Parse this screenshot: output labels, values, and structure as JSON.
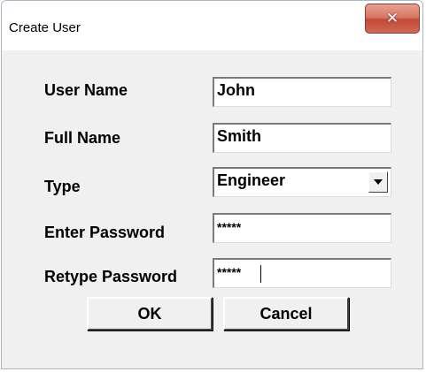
{
  "window": {
    "title": "Create User",
    "close_glyph": "✕",
    "close_icon": "close-icon"
  },
  "form": {
    "user_name": {
      "label": "User Name",
      "value": "John"
    },
    "full_name": {
      "label": "Full Name",
      "value": "Smith"
    },
    "type": {
      "label": "Type",
      "value": "Engineer",
      "arrow_icon": "dropdown-arrow-icon"
    },
    "enter_password": {
      "label": "Enter Password",
      "value": "*****"
    },
    "retype_password": {
      "label": "Retype Password",
      "value": "*****"
    }
  },
  "buttons": {
    "ok": "OK",
    "cancel": "Cancel"
  },
  "colors": {
    "close_button": "#c24a37",
    "dialog_face": "#f0f0f0",
    "titlebar": "#ffffff"
  }
}
